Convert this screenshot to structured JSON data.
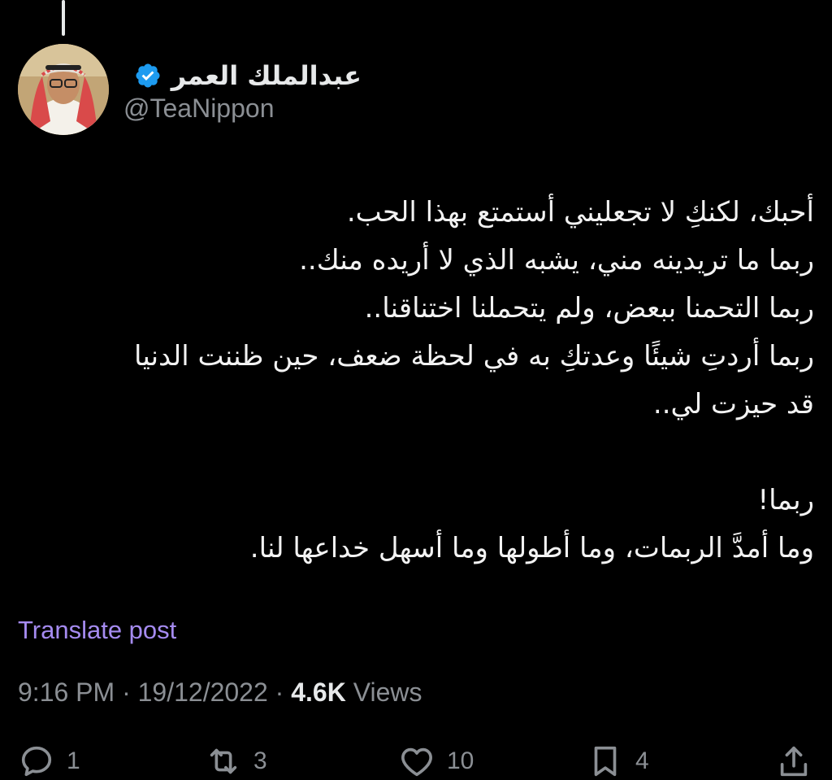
{
  "tweet": {
    "author": {
      "display_name": "عبدالملك العمر",
      "handle": "@TeaNippon",
      "verified": true,
      "verified_color": "#1d9bf0"
    },
    "text_lines": [
      "أحبك، لكنكِ لا تجعليني أستمتع بهذا الحب.",
      "ربما ما تريدينه مني، يشبه الذي لا أريده منك..",
      "ربما التحمنا ببعض، ولم يتحملنا اختناقنا..",
      "ربما أردتِ شيئًا وعدتكِ به في لحظة ضعف، حين ظننت الدنيا",
      "قد حيزت لي..",
      "",
      "ربما!",
      "وما أمدَّ الربمات، وما أطولها وما أسهل خداعها لنا."
    ],
    "translate_label": "Translate post",
    "time": "9:16 PM",
    "separator": "·",
    "date": "19/12/2022",
    "views_count": "4.6K",
    "views_label": "Views",
    "actions": {
      "replies": {
        "icon": "reply-icon",
        "count": "1"
      },
      "reposts": {
        "icon": "repost-icon",
        "count": "3"
      },
      "likes": {
        "icon": "heart-icon",
        "count": "10"
      },
      "bookmarks": {
        "icon": "bookmark-icon",
        "count": "4"
      },
      "share": {
        "icon": "share-icon"
      }
    },
    "colors": {
      "background": "#000000",
      "link": "#a58bf0",
      "secondary_text": "#8b8f94"
    }
  }
}
